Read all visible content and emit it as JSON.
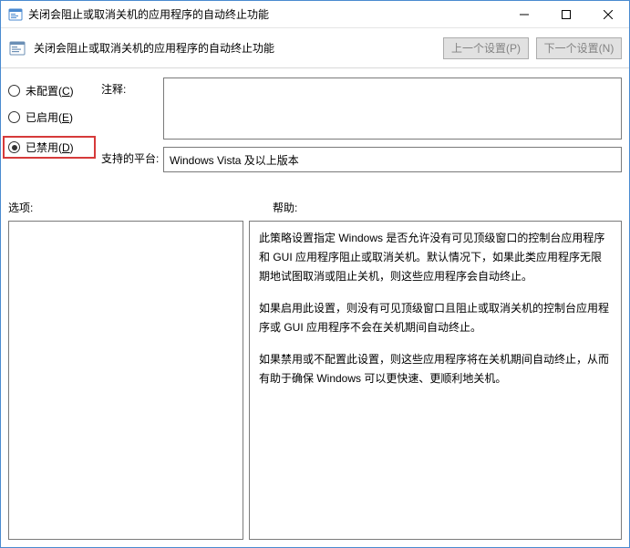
{
  "window": {
    "title": "关闭会阻止或取消关机的应用程序的自动终止功能"
  },
  "header": {
    "policy_title": "关闭会阻止或取消关机的应用程序的自动终止功能",
    "prev_setting": "上一个设置(P)",
    "next_setting": "下一个设置(N)"
  },
  "radios": {
    "not_configured": "未配置(",
    "not_configured_key": "C",
    "enabled": "已启用(",
    "enabled_key": "E",
    "disabled": "已禁用(",
    "disabled_key": "D",
    "close_paren": ")"
  },
  "fields": {
    "comment_label": "注释:",
    "platform_label": "支持的平台:",
    "platform_value": "Windows Vista 及以上版本"
  },
  "mid": {
    "options_label": "选项:",
    "help_label": "帮助:"
  },
  "help": {
    "p1": "此策略设置指定 Windows 是否允许没有可见顶级窗口的控制台应用程序和 GUI 应用程序阻止或取消关机。默认情况下，如果此类应用程序无限期地试图取消或阻止关机，则这些应用程序会自动终止。",
    "p2": "如果启用此设置，则没有可见顶级窗口且阻止或取消关机的控制台应用程序或 GUI 应用程序不会在关机期间自动终止。",
    "p3": "如果禁用或不配置此设置，则这些应用程序将在关机期间自动终止，从而有助于确保 Windows 可以更快速、更顺利地关机。"
  }
}
